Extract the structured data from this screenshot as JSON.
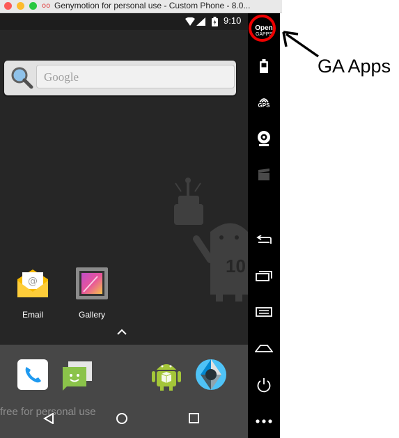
{
  "window": {
    "title": "Genymotion for personal use - Custom Phone - 8.0..."
  },
  "statusbar": {
    "time": "9:10"
  },
  "search_widget": {
    "placeholder": "Google"
  },
  "apps": [
    {
      "label": "Email",
      "icon": "email-icon"
    },
    {
      "label": "Gallery",
      "icon": "gallery-icon"
    }
  ],
  "dock": {
    "icons": [
      "phone-icon",
      "messaging-icon",
      "android-icon",
      "camera-icon"
    ]
  },
  "watermark": {
    "text": "free for personal use"
  },
  "toolbar": {
    "opengapps_line1": "Open",
    "opengapps_line2": "GAPPS",
    "gps_label": "GPS",
    "items": [
      "opengapps-icon",
      "battery-icon",
      "gps-icon",
      "webcam-icon",
      "video-icon",
      "back-icon",
      "recent-apps-icon",
      "menu-icon",
      "home-icon",
      "power-icon",
      "more-icon"
    ]
  },
  "annotation": {
    "label": "GA Apps"
  },
  "colors": {
    "screen_bg": "#262626",
    "dock_bg": "#474747",
    "toolbar_bg": "#000000",
    "highlight_ring": "#e00000"
  }
}
